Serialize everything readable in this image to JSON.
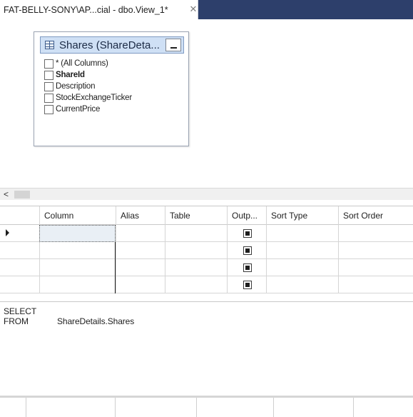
{
  "tab": {
    "title": "FAT-BELLY-SONY\\AP...cial - dbo.View_1*",
    "close_glyph": "✕"
  },
  "diagram": {
    "table_title": "Shares (ShareDeta...",
    "columns": [
      {
        "label": "* (All Columns)",
        "bold": false,
        "checked": false
      },
      {
        "label": "ShareId",
        "bold": true,
        "checked": false
      },
      {
        "label": "Description",
        "bold": false,
        "checked": false
      },
      {
        "label": "StockExchangeTicker",
        "bold": false,
        "checked": false
      },
      {
        "label": "CurrentPrice",
        "bold": false,
        "checked": false
      }
    ],
    "table_icon": "table-grid-icon",
    "minimize_icon": "minimize-icon"
  },
  "scroll": {
    "left_glyph": "<"
  },
  "criteria": {
    "headers": [
      "Column",
      "Alias",
      "Table",
      "Outp...",
      "Sort Type",
      "Sort Order"
    ],
    "row_count": 4,
    "output_checked": [
      true,
      true,
      true,
      true
    ],
    "current_row_icon": "row-pointer-icon"
  },
  "sql": {
    "select_kw": "SELECT",
    "from_kw": "FROM",
    "from_value": "ShareDetails.Shares"
  },
  "colors": {
    "tab_bar": "#2d3f6b",
    "table_header": "#cfe0f5",
    "active_cell": "#e9eff5"
  }
}
